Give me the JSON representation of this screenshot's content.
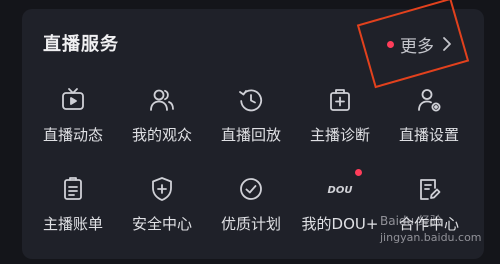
{
  "header": {
    "title": "直播服务",
    "more_label": "更多"
  },
  "colors": {
    "background": "#14151a",
    "card": "#1f2129",
    "badge": "#ff3d5a",
    "annotation": "#e2411d"
  },
  "items": [
    {
      "label": "直播动态",
      "icon": "tv-icon"
    },
    {
      "label": "我的观众",
      "icon": "audience-icon"
    },
    {
      "label": "直播回放",
      "icon": "replay-clock-icon"
    },
    {
      "label": "主播诊断",
      "icon": "diagnosis-kit-icon"
    },
    {
      "label": "直播设置",
      "icon": "user-settings-icon"
    },
    {
      "label": "主播账单",
      "icon": "bill-icon"
    },
    {
      "label": "安全中心",
      "icon": "shield-plus-icon"
    },
    {
      "label": "优质计划",
      "icon": "check-circle-icon"
    },
    {
      "label": "我的DOU+",
      "icon": "dou-logo-icon",
      "logo_text": "DOU",
      "badge": true
    },
    {
      "label": "合作中心",
      "icon": "edit-document-icon"
    }
  ],
  "watermark": {
    "brand": "Baidu 经验",
    "url": "jingyan.baidu.com"
  }
}
